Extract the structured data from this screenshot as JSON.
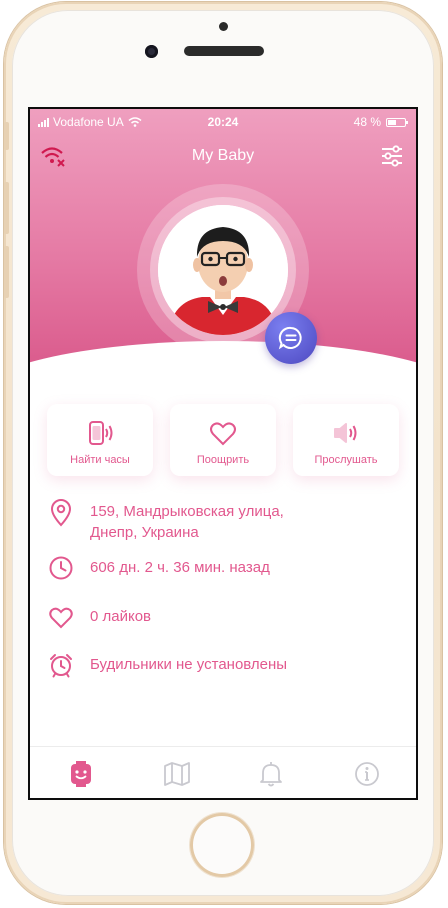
{
  "status_bar": {
    "carrier": "Vodafone UA",
    "time": "20:24",
    "battery": "48 %"
  },
  "nav": {
    "title": "My Baby"
  },
  "actions": [
    {
      "label": "Найти часы",
      "icon": "watch-signal-icon"
    },
    {
      "label": "Поощрить",
      "icon": "heart-icon"
    },
    {
      "label": "Прослушать",
      "icon": "speaker-icon"
    }
  ],
  "info": {
    "address_line1": "159, Мандрыковская улица,",
    "address_line2": "Днепр, Украина",
    "last_seen": "606 дн. 2 ч. 36 мин. назад",
    "likes": "0 лайков",
    "alarms": "Будильники не установлены"
  },
  "tabs": [
    {
      "icon": "watch-face-icon",
      "active": true
    },
    {
      "icon": "map-icon",
      "active": false
    },
    {
      "icon": "bell-icon",
      "active": false
    },
    {
      "icon": "info-icon",
      "active": false
    }
  ],
  "colors": {
    "accent": "#e2588e",
    "header_top": "#ef9fbf",
    "header_bottom": "#d9588a",
    "chat_button": "#5b59cf"
  }
}
